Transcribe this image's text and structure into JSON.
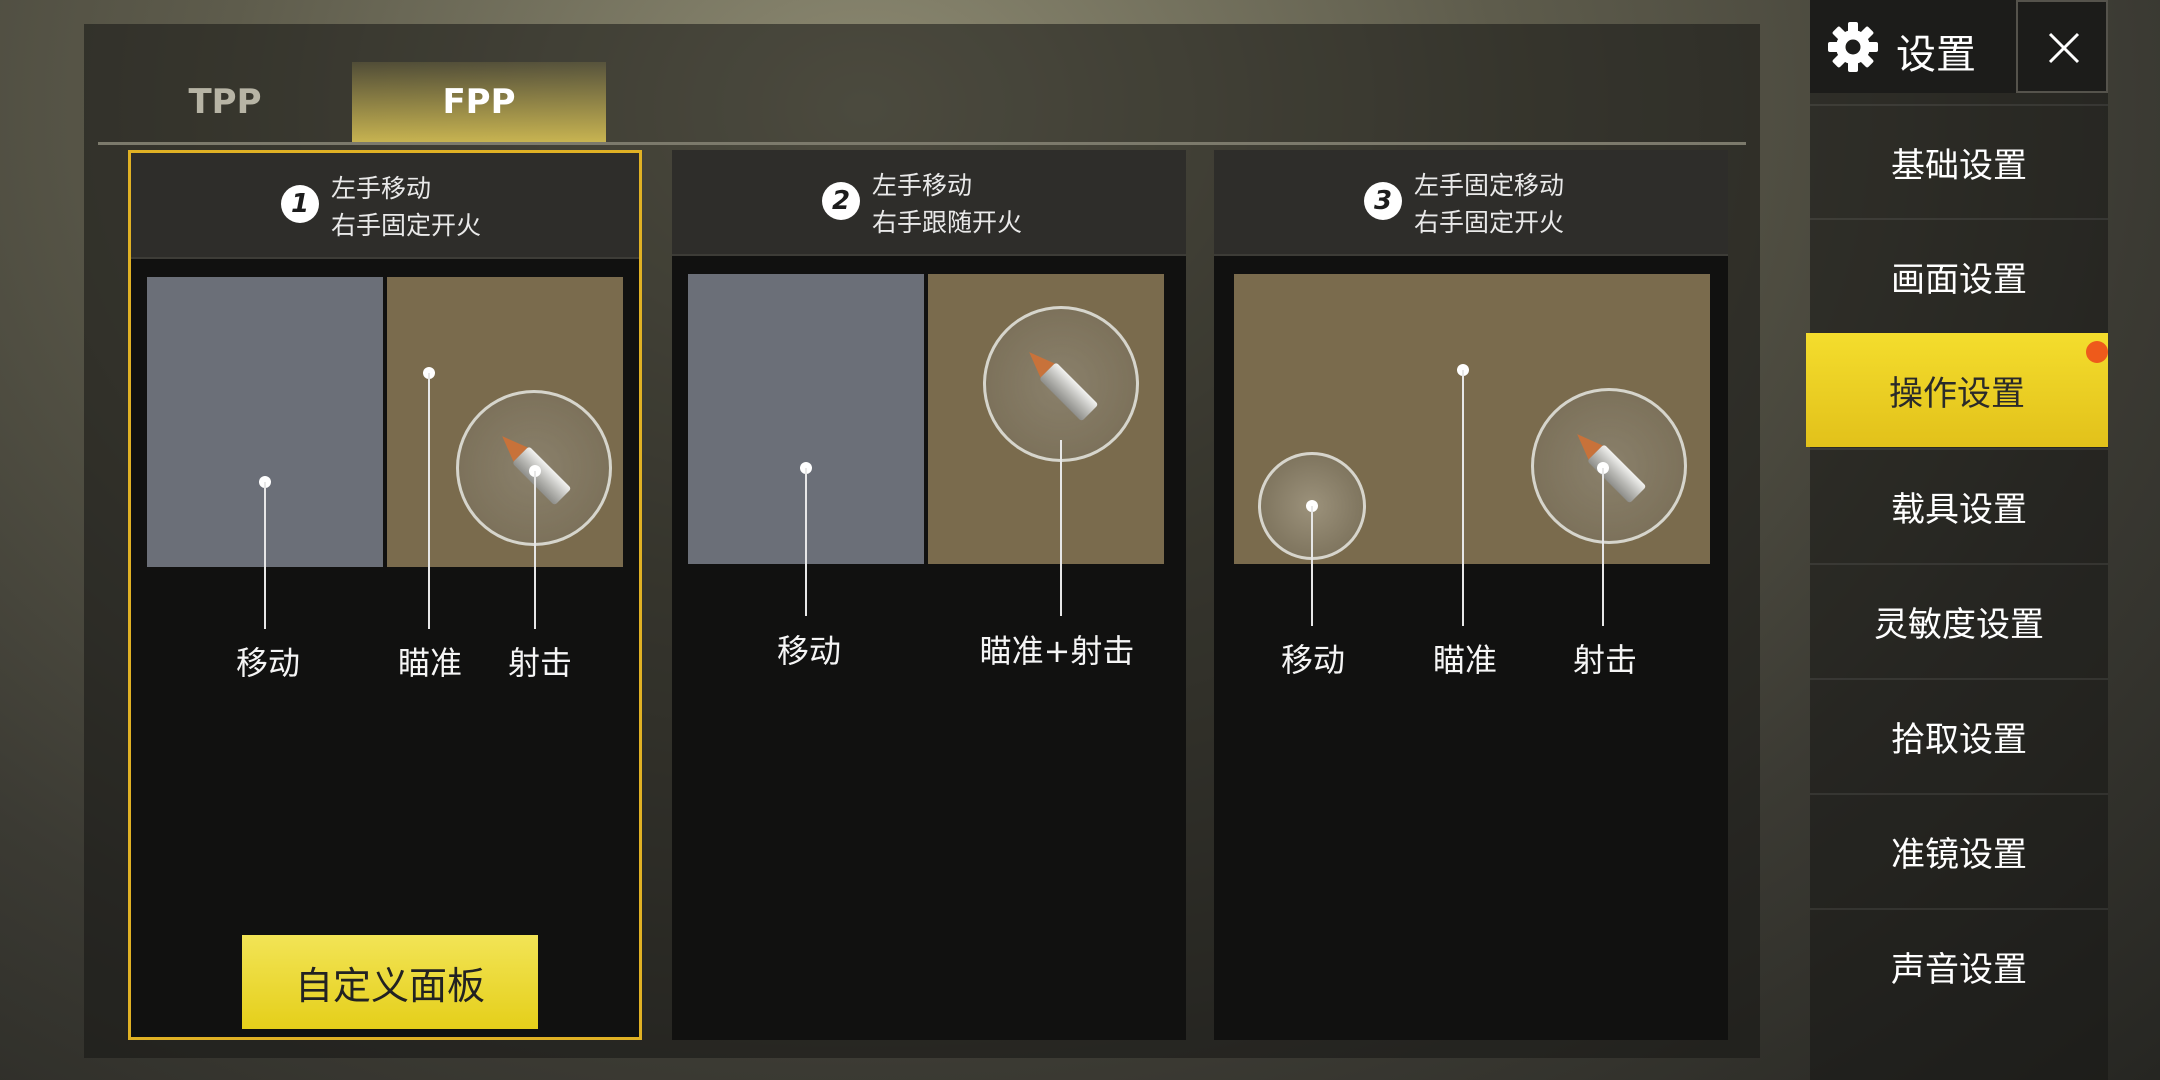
{
  "tabs": [
    {
      "label": "TPP",
      "active": false
    },
    {
      "label": "FPP",
      "active": true
    }
  ],
  "modes": [
    {
      "number": "1",
      "line1": "左手移动",
      "line2": "右手固定开火",
      "labels": {
        "move": "移动",
        "aim": "瞄准",
        "fire": "射击"
      },
      "selected": true
    },
    {
      "number": "2",
      "line1": "左手移动",
      "line2": "右手跟随开火",
      "labels": {
        "move": "移动",
        "aimfire": "瞄准+射击"
      },
      "selected": false
    },
    {
      "number": "3",
      "line1": "左手固定移动",
      "line2": "右手固定开火",
      "labels": {
        "move": "移动",
        "aim": "瞄准",
        "fire": "射击"
      },
      "selected": false
    }
  ],
  "custom_panel_label": "自定义面板",
  "sidebar": {
    "title": "设置",
    "items": [
      {
        "label": "基础设置"
      },
      {
        "label": "画面设置"
      },
      {
        "label": "操作设置",
        "active": true
      },
      {
        "label": "载具设置"
      },
      {
        "label": "灵敏度设置"
      },
      {
        "label": "拾取设置"
      },
      {
        "label": "准镜设置"
      },
      {
        "label": "声音设置"
      }
    ]
  },
  "colors": {
    "accent": "#e5cf1a",
    "selected_border": "#e0b124",
    "notify": "#ee5a1b"
  }
}
